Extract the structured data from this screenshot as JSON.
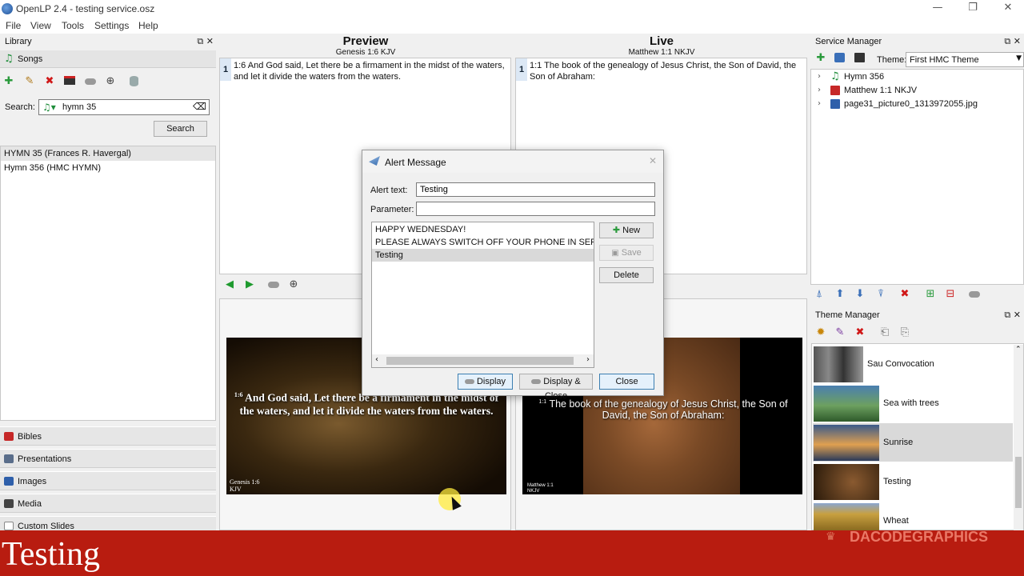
{
  "window": {
    "title": "OpenLP 2.4 - testing service.osz",
    "minimize": "—",
    "restore": "❐",
    "close": "✕"
  },
  "menu": [
    "File",
    "View",
    "Tools",
    "Settings",
    "Help"
  ],
  "library": {
    "title": "Library",
    "section": "Songs",
    "search_label": "Search:",
    "search_value": "hymn 35",
    "search_button": "Search",
    "results": [
      "HYMN 35 (Frances R. Havergal)",
      "Hymn 356 (HMC HYMN)"
    ],
    "categories": [
      {
        "label": "Bibles",
        "color": "#c62828"
      },
      {
        "label": "Presentations",
        "color": "#5a6d8a"
      },
      {
        "label": "Images",
        "color": "#2e5faa"
      },
      {
        "label": "Media",
        "color": "#444444"
      },
      {
        "label": "Custom Slides",
        "color": "#ffffff"
      }
    ]
  },
  "preview": {
    "heading": "Preview",
    "subtitle": "Genesis 1:6 KJV",
    "slide_number": "1",
    "slide_text": "1:6 And God said, Let there be a firmament in the midst of the waters, and let it divide the waters from the waters.",
    "screen_verse_num": "1:6",
    "screen_text": "And God said, Let there be a firmament in the midst of the waters, and let it divide the waters from the waters.",
    "screen_footer_line1": "Genesis 1:6",
    "screen_footer_line2": "KJV"
  },
  "live": {
    "heading": "Live",
    "subtitle": "Matthew 1:1 NKJV",
    "slide_number": "1",
    "slide_text": "1:1 The book of the genealogy of Jesus Christ, the Son of David, the Son of Abraham:",
    "screen_verse_num": "1:1",
    "screen_text": "The book of the genealogy of Jesus Christ, the Son of David, the Son of Abraham:",
    "screen_footer_line1": "Matthew 1:1",
    "screen_footer_line2": "NKJV"
  },
  "service_manager": {
    "title": "Service Manager",
    "theme_label": "Theme:",
    "theme_value": "First HMC Theme",
    "items": [
      {
        "label": "Hymn 356",
        "icon": "music-note-icon"
      },
      {
        "label": "Matthew 1:1 NKJV",
        "icon": "bible-icon"
      },
      {
        "label": "page31_picture0_1313972055.jpg",
        "icon": "image-icon"
      }
    ]
  },
  "theme_manager": {
    "title": "Theme Manager",
    "themes": [
      {
        "label": "Sau Convocation",
        "selected": false
      },
      {
        "label": "Sea with trees",
        "selected": false
      },
      {
        "label": "Sunrise",
        "selected": true
      },
      {
        "label": "Testing",
        "selected": false
      },
      {
        "label": "Wheat",
        "selected": false
      }
    ]
  },
  "alert_dialog": {
    "title": "Alert Message",
    "alert_text_label": "Alert text:",
    "alert_text_value": "Testing",
    "parameter_label": "Parameter:",
    "parameter_value": "",
    "messages": [
      "HAPPY WEDNESDAY!",
      "PLEASE ALWAYS SWITCH OFF YOUR PHONE IN SERVICE",
      "Testing"
    ],
    "selected_message": "Testing",
    "new_button": "New",
    "save_button": "Save",
    "delete_button": "Delete",
    "display_button": "Display",
    "display_close_button": "Display & Close",
    "close_button": "Close"
  },
  "alert_banner": {
    "text": "Testing"
  },
  "watermark": "DACODEGRAPHICS"
}
